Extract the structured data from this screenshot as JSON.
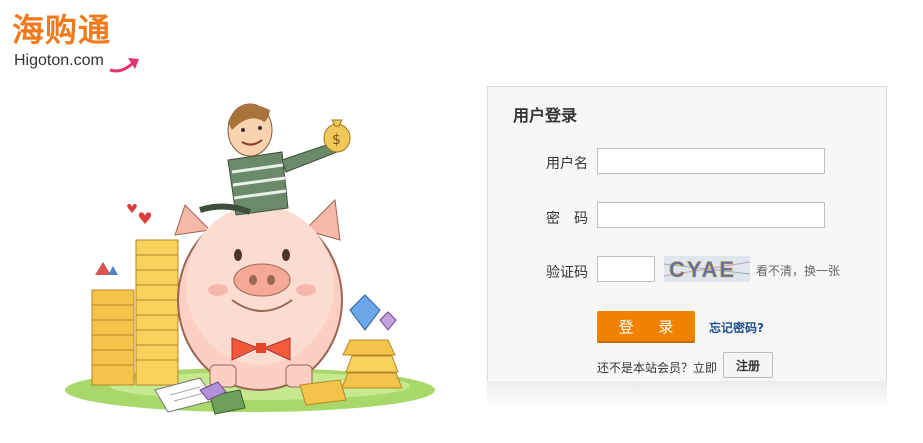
{
  "logo": {
    "cn_text": "海购通",
    "en_text": "Higoton.com",
    "colors": {
      "brand_orange": "#f07a1d",
      "arrow_pink": "#e0336b"
    }
  },
  "login": {
    "title": "用户登录",
    "username_label": "用户名",
    "username_value": "",
    "password_label": "密　码",
    "password_value": "",
    "captcha_label": "验证码",
    "captcha_value": "",
    "captcha_image_text": "CYAE",
    "refresh_text": "看不清，换一张",
    "login_button": "登 录",
    "forgot_link": "忘记密码?",
    "register_prompt": "还不是本站会员？立即",
    "register_button": "注册",
    "colors": {
      "button_orange": "#f08200",
      "link_blue": "#1a4f8c",
      "panel_bg": "#f7f7f7"
    }
  }
}
